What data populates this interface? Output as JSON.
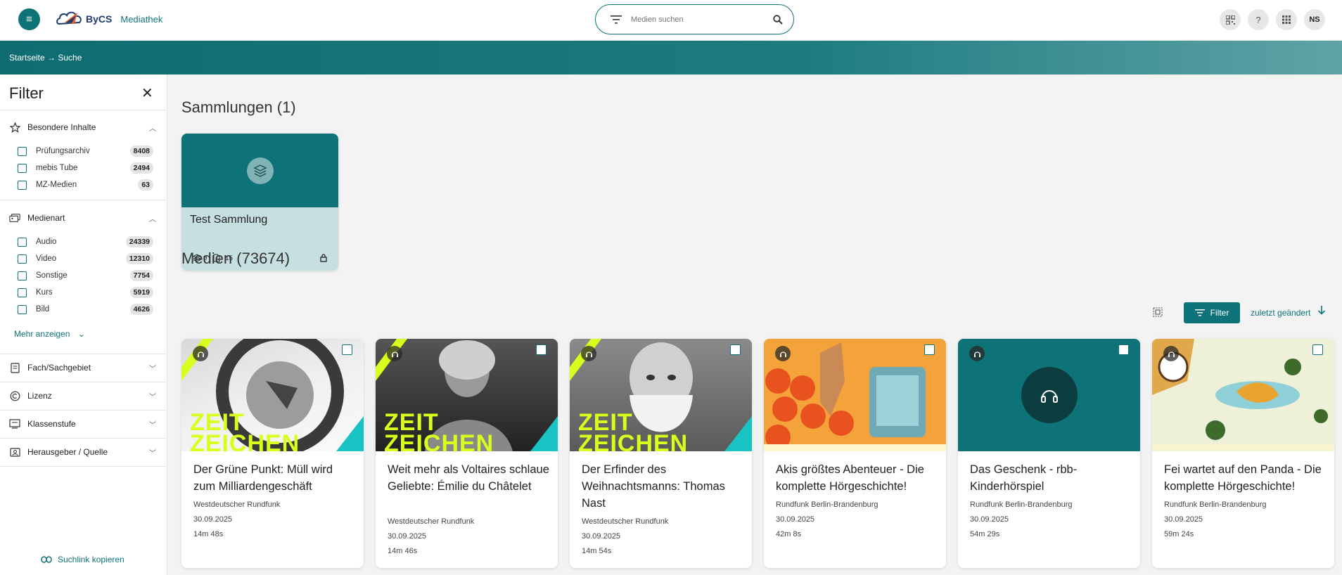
{
  "header": {
    "brand": "ByCS",
    "product": "Mediathek",
    "search_placeholder": "Medien suchen",
    "avatar_initials": "NS"
  },
  "breadcrumb": "Startseite → Suche",
  "sidebar": {
    "title": "Filter",
    "sections": [
      {
        "label": "Besondere Inhalte",
        "expanded": true,
        "options": [
          {
            "label": "Prüfungsarchiv",
            "count": "8408"
          },
          {
            "label": "mebis Tube",
            "count": "2494"
          },
          {
            "label": "MZ-Medien",
            "count": "63"
          }
        ]
      },
      {
        "label": "Medienart",
        "expanded": true,
        "options": [
          {
            "label": "Audio",
            "count": "24339"
          },
          {
            "label": "Video",
            "count": "12310"
          },
          {
            "label": "Sonstige",
            "count": "7754"
          },
          {
            "label": "Kurs",
            "count": "5919"
          },
          {
            "label": "Bild",
            "count": "4626"
          }
        ]
      },
      {
        "label": "Fach/Sachgebiet",
        "expanded": false
      },
      {
        "label": "Lizenz",
        "expanded": false
      },
      {
        "label": "Klassenstufe",
        "expanded": false
      },
      {
        "label": "Herausgeber / Quelle",
        "expanded": false
      }
    ],
    "more_label": "Mehr anzeigen",
    "copy_link_label": "Suchlink kopieren"
  },
  "collections": {
    "heading": "Sammlungen (1)",
    "items": [
      {
        "name": "Test Sammlung",
        "collections_count": "0",
        "media_count": "15"
      }
    ]
  },
  "media": {
    "heading": "Medien (73674)",
    "filter_label": "Filter",
    "sort_label": "zuletzt geändert",
    "items": [
      {
        "title": "Der Grüne Punkt: Müll wird zum Milliardengeschäft",
        "publisher": "Westdeutscher Rundfunk",
        "date": "30.09.2025",
        "duration": "14m 48s"
      },
      {
        "title": "Weit mehr als Voltaires schlaue Geliebte: Émilie du Châtelet",
        "publisher": "Westdeutscher Rundfunk",
        "date": "30.09.2025",
        "duration": "14m 46s"
      },
      {
        "title": "Der Erfinder des Weihnachtsmanns: Thomas Nast",
        "publisher": "Westdeutscher Rundfunk",
        "date": "30.09.2025",
        "duration": "14m 54s"
      },
      {
        "title": "Akis größtes Abenteuer - Die komplette Hörgeschichte!",
        "publisher": "Rundfunk Berlin-Brandenburg",
        "date": "30.09.2025",
        "duration": "42m 8s"
      },
      {
        "title": "Das Geschenk - rbb-Kinderhörspiel",
        "publisher": "Rundfunk Berlin-Brandenburg",
        "date": "30.09.2025",
        "duration": "54m 29s"
      },
      {
        "title": "Fei wartet auf den Panda - Die komplette Hörgeschichte!",
        "publisher": "Rundfunk Berlin-Brandenburg",
        "date": "30.09.2025",
        "duration": "59m 24s"
      }
    ]
  },
  "colors": {
    "accent": "#0e7379",
    "zeitzeichen": "#d6ff1e"
  }
}
